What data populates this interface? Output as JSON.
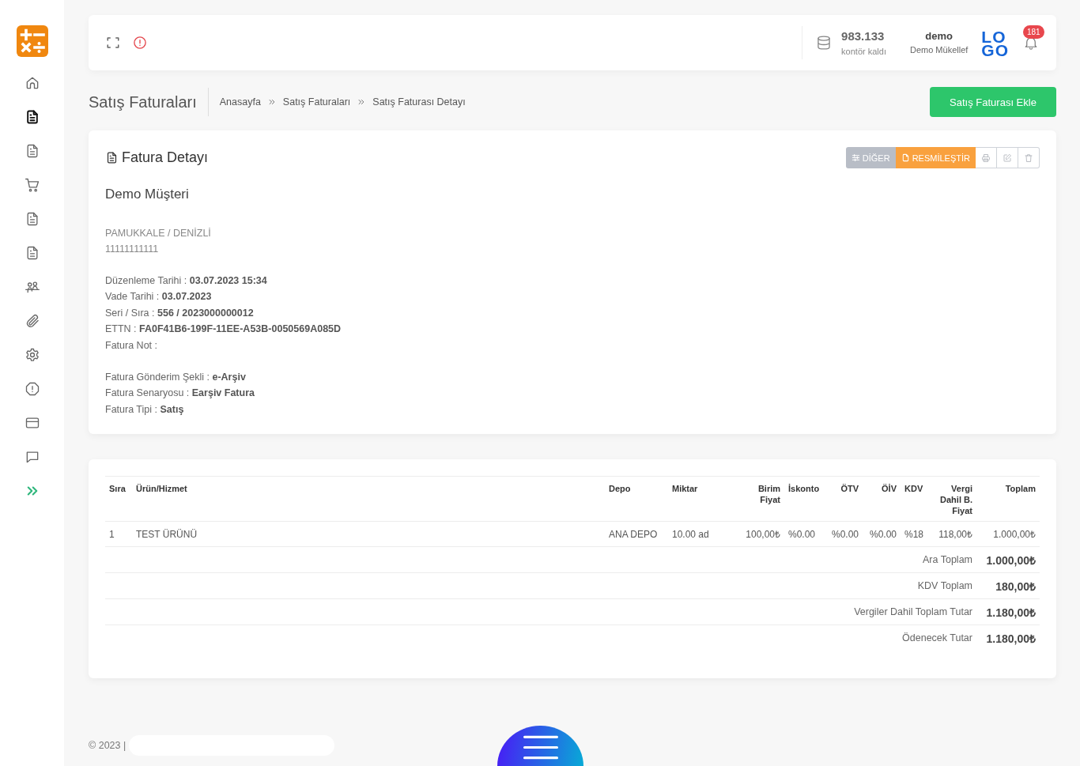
{
  "sidebar": {
    "items": [
      {
        "kind": "home",
        "selected": false
      },
      {
        "kind": "document",
        "selected": true
      },
      {
        "kind": "document",
        "selected": false
      },
      {
        "kind": "cart",
        "selected": false
      },
      {
        "kind": "document",
        "selected": false
      },
      {
        "kind": "document",
        "selected": false
      },
      {
        "kind": "users",
        "selected": false
      },
      {
        "kind": "attachment",
        "selected": false
      },
      {
        "kind": "settings",
        "selected": false
      },
      {
        "kind": "alert",
        "selected": false
      },
      {
        "kind": "card",
        "selected": false
      },
      {
        "kind": "chat",
        "selected": false
      },
      {
        "kind": "expand",
        "selected": false
      }
    ]
  },
  "top_bar": {
    "credits": {
      "amount": "983.133",
      "label": "kontör kaldı"
    },
    "user": {
      "name": "demo",
      "company": "Demo Mükellef"
    },
    "brand_logo": [
      "LO",
      "GO"
    ],
    "notifications": {
      "count": "181"
    }
  },
  "page_header": {
    "title": "Satış Faturaları",
    "breadcrumb": [
      "Anasayfa",
      "Satış Faturaları",
      "Satış Faturası Detayı"
    ],
    "add_button": "Satış Faturası Ekle"
  },
  "invoice_card": {
    "title": "Fatura Detayı",
    "actions": [
      {
        "kind": "other",
        "label": "DİĞER"
      },
      {
        "kind": "formalize",
        "label": "RESMİLEŞTİR"
      },
      {
        "kind": "print"
      },
      {
        "kind": "edit"
      },
      {
        "kind": "delete"
      }
    ],
    "customer": {
      "name": "Demo Müşteri",
      "address": "PAMUKKALE / DENİZLİ",
      "tax_number": "11111111111"
    },
    "detail_groups": [
      [
        "Düzenleme Tarihi : **03.07.2023 15:34**",
        "Vade Tarihi : **03.07.2023**",
        "Seri / Sıra : **556 / 2023000000012**",
        "ETTN : **FA0F41B6-199F-11EE-A53B-0050569A085D**",
        "Fatura Not :"
      ],
      [
        "Fatura Gönderim Şekli : **e-Arşiv**",
        "Fatura Senaryosu : **Earşiv Fatura**",
        "Fatura Tipi : **Satış**"
      ]
    ]
  },
  "items_table": {
    "columns": [
      "Sıra",
      "Ürün/Hizmet",
      "Depo",
      "Miktar",
      "Birim Fiyat",
      "İskonto",
      "ÖTV",
      "ÖİV",
      "KDV",
      "Vergi Dahil B. Fiyat",
      "Toplam"
    ],
    "rows": [
      [
        "1",
        "TEST ÜRÜNÜ",
        "ANA DEPO",
        "10.00 ad",
        "100,00₺",
        "%0.00",
        "%0.00",
        "%0.00",
        "%18",
        "118,00₺",
        "1.000,00₺"
      ]
    ],
    "totals": [
      {
        "label": "Ara Toplam",
        "value": "1.000,00₺"
      },
      {
        "label": "KDV Toplam",
        "value": "180,00₺"
      },
      {
        "label": "Vergiler Dahil Toplam Tutar",
        "value": "1.180,00₺"
      },
      {
        "label": "Ödenecek Tutar",
        "value": "1.180,00₺"
      }
    ]
  },
  "footer": {
    "copyright": "© 2023 |"
  }
}
